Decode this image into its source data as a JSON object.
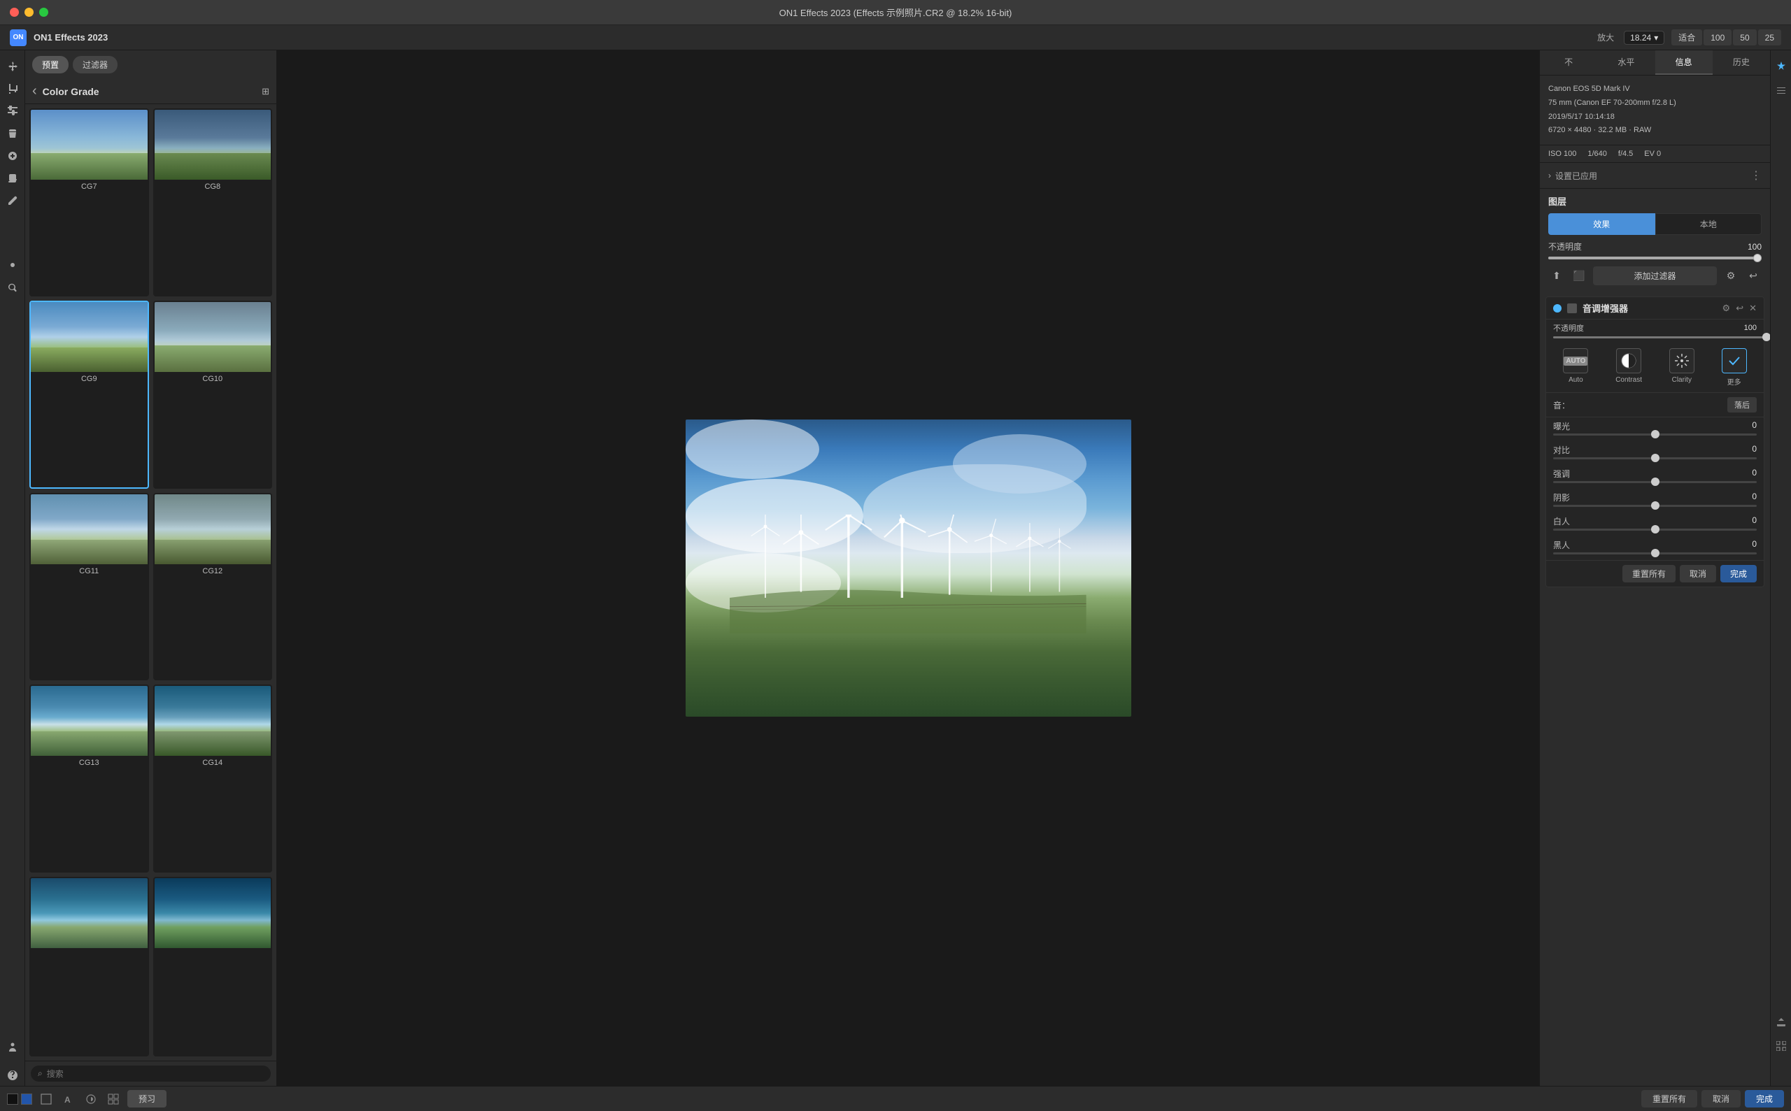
{
  "titleBar": {
    "title": "ON1 Effects 2023 (Effects 示例照片.CR2 @ 18.2% 16-bit)"
  },
  "topBar": {
    "appName": "ON1 Effects 2023",
    "zoomLabel": "放大",
    "zoomValue": "18.24",
    "fitOptions": [
      "适合",
      "100",
      "50",
      "25"
    ]
  },
  "leftPanel": {
    "tabs": [
      "预置",
      "过滤器"
    ],
    "activeTab": "预置",
    "backLabel": "Color Grade",
    "presets": [
      {
        "id": "CG7",
        "label": "CG7",
        "selected": false
      },
      {
        "id": "CG8",
        "label": "CG8",
        "selected": false
      },
      {
        "id": "CG9",
        "label": "CG9",
        "selected": true
      },
      {
        "id": "CG10",
        "label": "CG10",
        "selected": false
      },
      {
        "id": "CG11",
        "label": "CG11",
        "selected": false
      },
      {
        "id": "CG12",
        "label": "CG12",
        "selected": false
      },
      {
        "id": "CG13",
        "label": "CG13",
        "selected": false
      },
      {
        "id": "CG14",
        "label": "CG14",
        "selected": false
      }
    ],
    "searchPlaceholder": "搜索"
  },
  "rightPanel": {
    "infoTabs": [
      "不",
      "水平",
      "信息",
      "历史"
    ],
    "activeTab": "信息",
    "camera": "Canon EOS 5D Mark IV",
    "lens": "75 mm (Canon EF 70-200mm f/2.8 L)",
    "date": "2019/5/17  10:14:18",
    "resolution": "6720 × 4480 · 32.2 MB · RAW",
    "iso": "ISO 100",
    "shutter": "1/640",
    "aperture": "f/4.5",
    "ev": "EV 0",
    "settingsApplied": "设置已应用",
    "layersTitle": "图层",
    "layerTabs": [
      "效果",
      "本地"
    ],
    "opacityLabel": "不透明度",
    "opacityValue": "100",
    "addFilterLabel": "添加过滤器",
    "toneEnhancer": {
      "title": "音调增强器",
      "opacityLabel": "不透明度",
      "opacityValue": "100",
      "quickActions": [
        {
          "id": "auto",
          "label": "Auto",
          "icon": "AUTO"
        },
        {
          "id": "contrast",
          "label": "Contrast",
          "icon": "◐"
        },
        {
          "id": "clarity",
          "label": "Clarity",
          "icon": "✳"
        },
        {
          "id": "more",
          "label": "更多",
          "icon": "✓"
        }
      ],
      "toneLabel": "音：",
      "toneBtnLabel": "落后",
      "sliders": [
        {
          "label": "曝光",
          "value": "0",
          "position": 0.5
        },
        {
          "label": "对比",
          "value": "0",
          "position": 0.5
        },
        {
          "label": "强调",
          "value": "0",
          "position": 0.5
        },
        {
          "label": "阴影",
          "value": "0",
          "position": 0.5
        },
        {
          "label": "白人",
          "value": "0",
          "position": 0.5
        },
        {
          "label": "黑人",
          "value": "0",
          "position": 0.5
        }
      ],
      "bottomButtons": [
        "重置所有",
        "取消",
        "完成"
      ]
    }
  },
  "bottomBar": {
    "previewLabel": "预习",
    "actionButtons": [
      "重置所有",
      "取消",
      "完成"
    ]
  },
  "icons": {
    "back": "‹",
    "grid": "⊞",
    "search": "⌕",
    "gear": "⚙",
    "undo": "↩",
    "close": "✕",
    "upload": "⬆",
    "camera2": "⬛",
    "chevronDown": "▾",
    "chevronRight": "›"
  }
}
